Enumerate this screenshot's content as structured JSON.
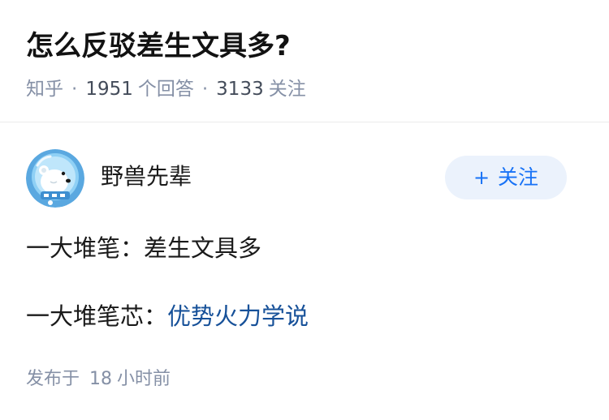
{
  "question": {
    "title": "怎么反驳差生文具多?",
    "source": "知乎",
    "separator": "·",
    "answer_count": "1951",
    "answer_label": "个回答",
    "follower_count": "3133",
    "follower_label": "关注"
  },
  "author": {
    "name": "野兽先辈",
    "avatar_icon": "polar-bear-astronaut-avatar",
    "follow_plus": "+",
    "follow_label": "关注"
  },
  "answer": {
    "line1": "一大堆笔：差生文具多",
    "line2_prefix": "一大堆笔芯：",
    "line2_link": "优势火力学说",
    "publish_prefix": "发布于",
    "publish_num": "18",
    "publish_suffix": "小时前"
  },
  "colors": {
    "link": "#175199",
    "follow_text": "#1772f6",
    "follow_bg": "#ebf2fc",
    "meta": "#8590a6"
  }
}
